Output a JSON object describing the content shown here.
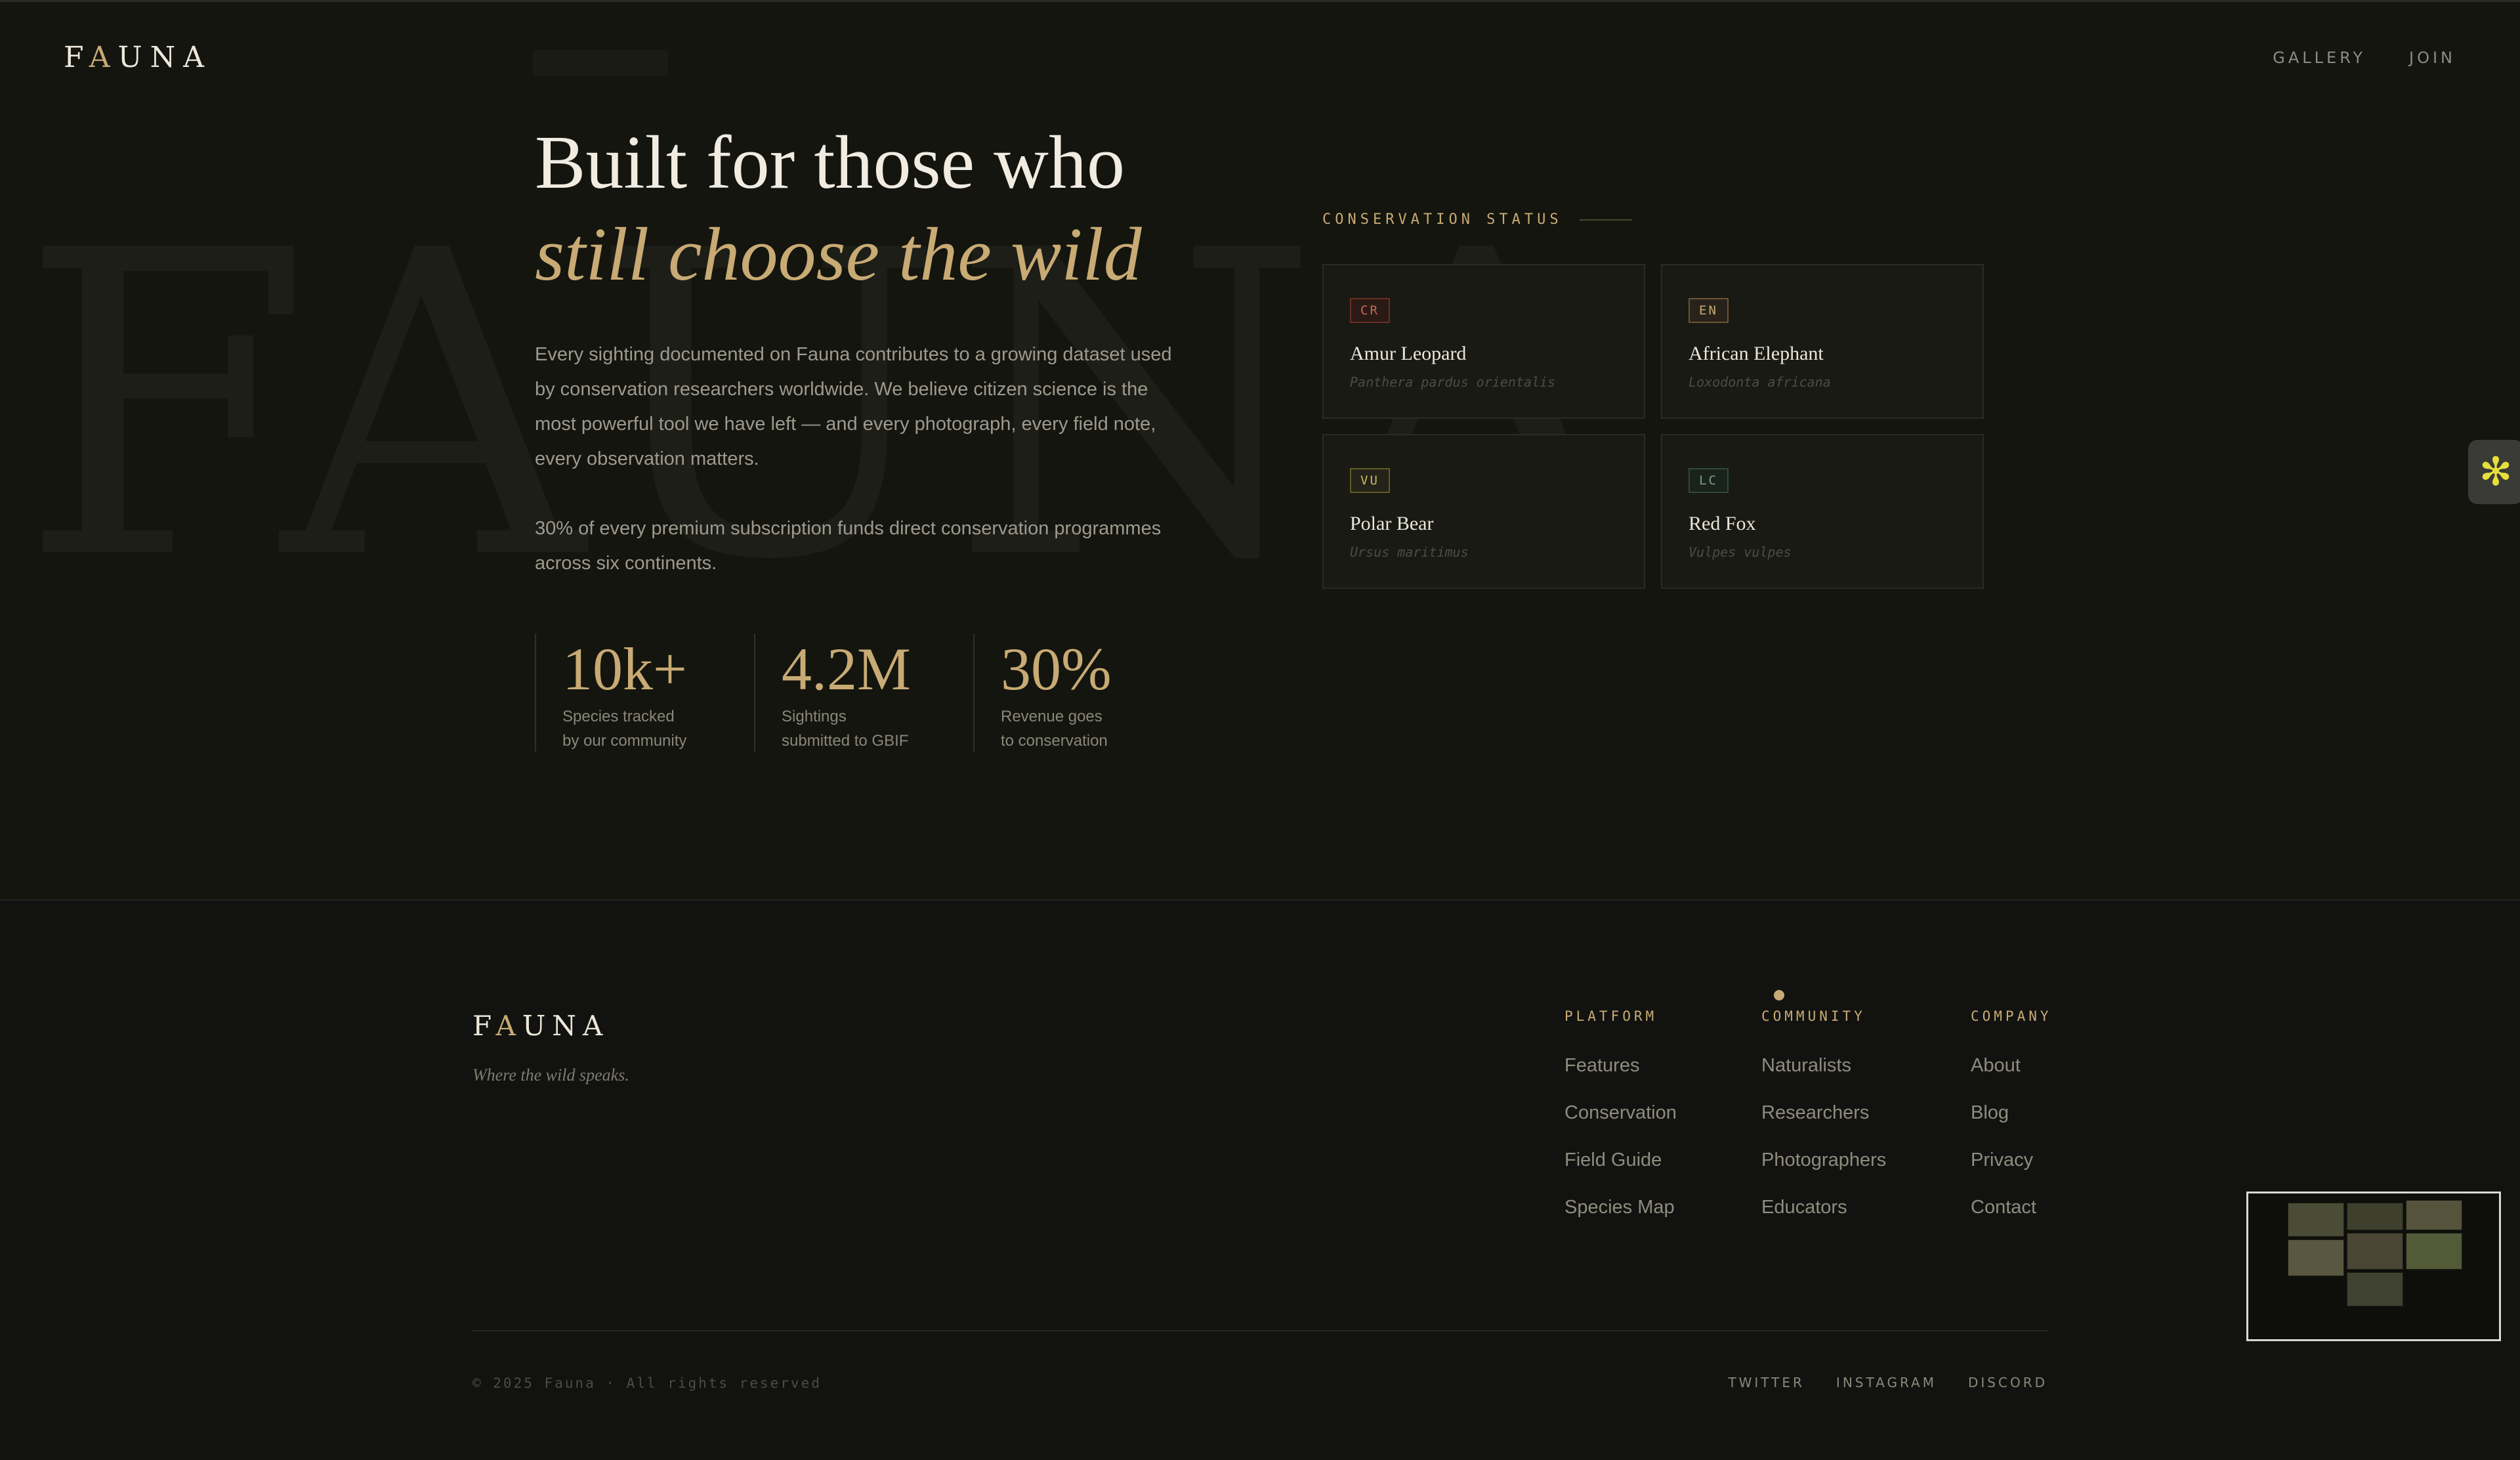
{
  "header": {
    "logo_prefix": "F",
    "logo_accent": "A",
    "logo_suffix": "UNA",
    "nav": [
      "GALLERY",
      "JOIN"
    ]
  },
  "watermark": "FAUNA",
  "hero": {
    "title_line1": "Built for those who",
    "title_line2": "still choose the wild",
    "paragraph1": "Every sighting documented on Fauna contributes to a growing dataset used by conservation researchers worldwide. We believe citizen science is the most powerful tool we have left — and every photograph, every field note, every observation matters.",
    "paragraph2": "30% of every premium subscription funds direct conservation programmes across six continents."
  },
  "stats": [
    {
      "value": "10k+",
      "label": "Species tracked\nby our community"
    },
    {
      "value": "4.2M",
      "label": "Sightings\nsubmitted to GBIF"
    },
    {
      "value": "30%",
      "label": "Revenue goes\nto conservation"
    }
  ],
  "conservation": {
    "heading": "CONSERVATION STATUS",
    "cards": [
      {
        "badge": "CR",
        "name": "Amur Leopard",
        "scientific": "Panthera pardus orientalis"
      },
      {
        "badge": "EN",
        "name": "African Elephant",
        "scientific": "Loxodonta africana"
      },
      {
        "badge": "VU",
        "name": "Polar Bear",
        "scientific": "Ursus maritimus"
      },
      {
        "badge": "LC",
        "name": "Red Fox",
        "scientific": "Vulpes vulpes"
      }
    ]
  },
  "side_widget": {
    "icon": "asterisk-icon",
    "glyph": "✻"
  },
  "footer": {
    "logo_prefix": "F",
    "logo_accent": "A",
    "logo_suffix": "UNA",
    "tagline": "Where the wild speaks.",
    "columns": [
      {
        "heading": "PLATFORM",
        "links": [
          "Features",
          "Conservation",
          "Field Guide",
          "Species Map"
        ]
      },
      {
        "heading": "COMMUNITY",
        "links": [
          "Naturalists",
          "Researchers",
          "Photographers",
          "Educators"
        ]
      },
      {
        "heading": "COMPANY",
        "links": [
          "About",
          "Blog",
          "Privacy",
          "Contact"
        ]
      }
    ],
    "copyright": "© 2025 Fauna · All rights reserved",
    "social": [
      "TWITTER",
      "INSTAGRAM",
      "DISCORD"
    ]
  },
  "colors": {
    "background": "#14150f",
    "accent_gold": "#c8aa74",
    "text_light": "#ece7da",
    "status_cr": "#c46a55",
    "status_en": "#c8aa74",
    "status_vu": "#c7bb5a",
    "status_lc": "#7fa07f"
  }
}
